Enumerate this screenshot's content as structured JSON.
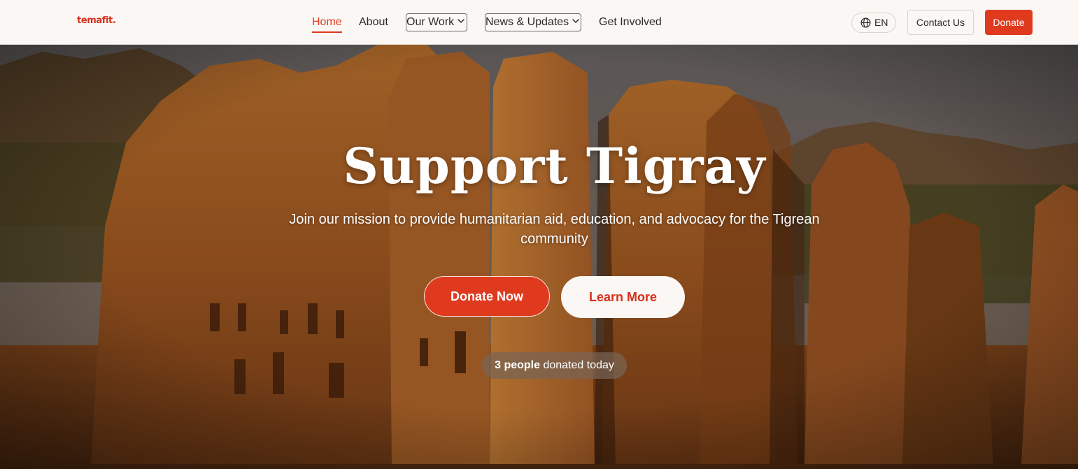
{
  "brand": {
    "logo_text": "temafit.",
    "color": "#d6301a"
  },
  "nav": {
    "items": [
      {
        "label": "Home",
        "active": true
      },
      {
        "label": "About"
      },
      {
        "label": "Our Work",
        "dropdown": true
      },
      {
        "label": "News & Updates",
        "dropdown": true
      },
      {
        "label": "Get Involved"
      }
    ]
  },
  "header": {
    "language": {
      "label": "EN",
      "icon": "globe-icon"
    },
    "contact_label": "Contact Us",
    "donate_label": "Donate"
  },
  "hero": {
    "title": "Support Tigray",
    "subtitle": "Join our mission to provide humanitarian aid, education, and advocacy for the Tigrean community",
    "primary_cta": "Donate Now",
    "secondary_cta": "Learn More",
    "donation_count": "3 people",
    "donation_suffix": " donated today"
  },
  "colors": {
    "accent": "#e03a1e",
    "header_bg": "#faf7f4",
    "text_dark": "#2b2b2b"
  }
}
